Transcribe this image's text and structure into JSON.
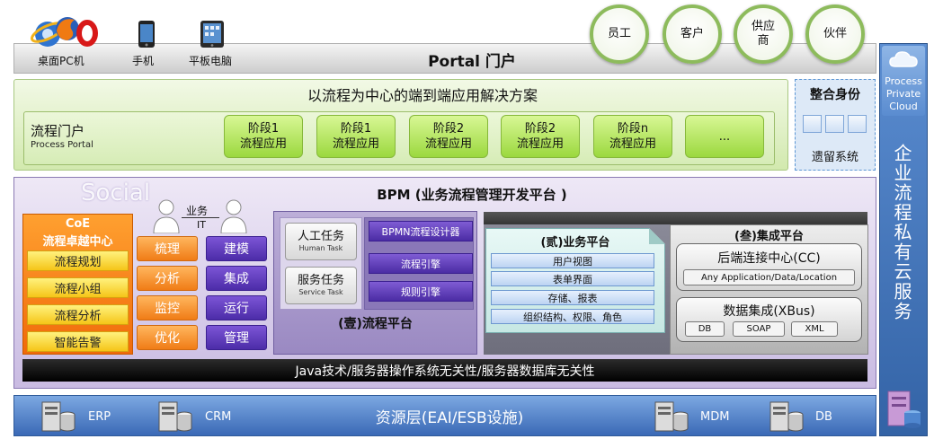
{
  "devices": {
    "desktop": "桌面PC机",
    "phone": "手机",
    "tablet": "平板电脑"
  },
  "portal": {
    "title": "Portal 门户"
  },
  "audiences": [
    "员工",
    "客户",
    "供应商",
    "伙伴"
  ],
  "solution": {
    "title": "以流程为中心的端到端应用解决方案",
    "portal_cn": "流程门户",
    "portal_en": "Process Portal",
    "stages": [
      {
        "stage": "阶段1",
        "app": "流程应用"
      },
      {
        "stage": "阶段1",
        "app": "流程应用"
      },
      {
        "stage": "阶段2",
        "app": "流程应用"
      },
      {
        "stage": "阶段2",
        "app": "流程应用"
      },
      {
        "stage": "阶段n",
        "app": "流程应用"
      }
    ],
    "more": "..."
  },
  "identity": {
    "title": "整合身份",
    "legacy": "遗留系统"
  },
  "cloud": {
    "lines": [
      "Process",
      "Private",
      "Cloud"
    ],
    "service": "企业流程私有云服务"
  },
  "bpm": {
    "social": "Social",
    "title": "BPM (业务流程管理开发平台 )"
  },
  "coe": {
    "title": "CoE",
    "subtitle": "流程卓越中心",
    "items": [
      "流程规划",
      "流程小组",
      "流程分析",
      "智能告警"
    ]
  },
  "people": {
    "business": "业务",
    "it": "IT"
  },
  "business_actions": [
    "梳理",
    "分析",
    "监控",
    "优化"
  ],
  "it_actions": [
    "建模",
    "集成",
    "运行",
    "管理"
  ],
  "process_platform": {
    "title": "(壹)流程平台",
    "human_task_cn": "人工任务",
    "human_task_en": "Human Task",
    "service_task_cn": "服务任务",
    "service_task_en": "Service Task",
    "tools": [
      "BPMN流程设计器",
      "流程引擎",
      "规则引擎"
    ]
  },
  "business_platform": {
    "title": "(贰)业务平台",
    "items": [
      "用户视图",
      "表单界面",
      "存储、报表",
      "组织结构、权限、角色"
    ]
  },
  "integration_platform": {
    "title": "(叁)集成平台",
    "cc": "后端连接中心(CC)",
    "cc_sub": "Any Application/Data/Location",
    "xbus": "数据集成(XBus)",
    "xbus_items": [
      "DB",
      "SOAP",
      "XML"
    ]
  },
  "foundation": "Java技术/服务器操作系统无关性/服务器数据库无关性",
  "resource": {
    "title": "资源层(EAI/ESB设施)",
    "systems": [
      "ERP",
      "CRM",
      "MDM",
      "DB"
    ]
  },
  "colors": {
    "audience_ring": "#8dbb5c",
    "stage_green": "#9bd83e",
    "coe_orange": "#f06a0a",
    "coe_item_yellow": "#f5c518",
    "action_orange": "#f07c16",
    "action_purple": "#4c2ca8",
    "bpm_lavender": "#c9bbe2",
    "cloud_blue": "#3363a6",
    "resource_blue": "#3a69b6"
  }
}
